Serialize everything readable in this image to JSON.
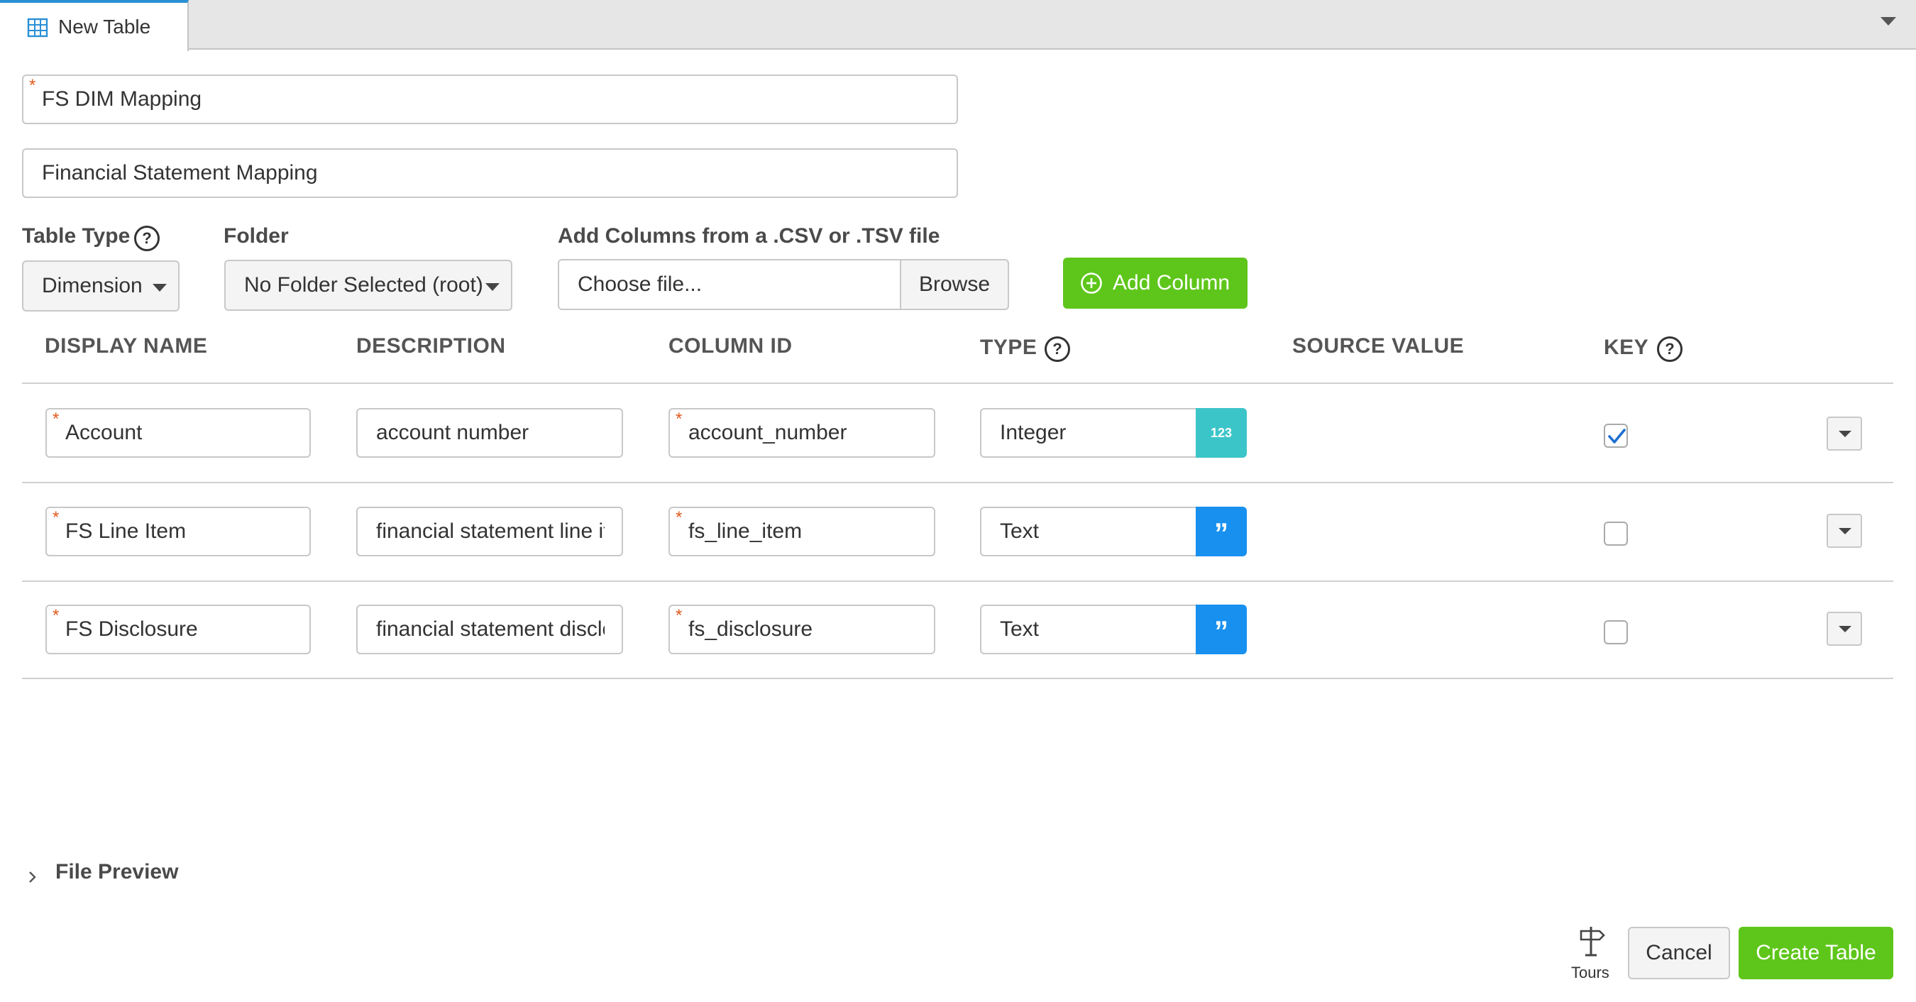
{
  "tab": {
    "label": "New Table",
    "icon": "table-grid-icon"
  },
  "form": {
    "name_value": "FS DIM Mapping",
    "description_value": "Financial Statement Mapping",
    "required_mark": "*"
  },
  "table_type": {
    "label": "Table Type",
    "help": "?",
    "value": "Dimension"
  },
  "folder": {
    "label": "Folder",
    "value": "No Folder Selected (root)"
  },
  "import": {
    "label": "Add Columns from a .CSV or .TSV file",
    "placeholder": "Choose file...",
    "browse_label": "Browse"
  },
  "add_column": {
    "label": "Add Column",
    "icon": "plus-circle-icon"
  },
  "columns_header": {
    "display_name": "DISPLAY NAME",
    "description": "DESCRIPTION",
    "column_id": "COLUMN ID",
    "type": "TYPE",
    "source_value": "SOURCE VALUE",
    "key": "KEY",
    "help": "?"
  },
  "rows": [
    {
      "display_name": "Account",
      "description": "account number",
      "column_id": "account_number",
      "type": "Integer",
      "type_badge": "123",
      "type_icon": "number-icon",
      "key": true
    },
    {
      "display_name": "FS Line Item",
      "description": "financial statement line item",
      "column_id": "fs_line_item",
      "type": "Text",
      "type_badge": "”",
      "type_icon": "quote-icon",
      "key": false
    },
    {
      "display_name": "FS Disclosure",
      "description": "financial statement disclosure",
      "column_id": "fs_disclosure",
      "type": "Text",
      "type_badge": "”",
      "type_icon": "quote-icon",
      "key": false
    }
  ],
  "file_preview": {
    "label": "File Preview",
    "icon": "chevron-right-icon"
  },
  "footer": {
    "tours_label": "Tours",
    "tours_icon": "signpost-icon",
    "cancel_label": "Cancel",
    "create_label": "Create Table"
  },
  "colors": {
    "accent_blue": "#2b8fd6",
    "green": "#5ec61a",
    "teal": "#3cc5c9",
    "text_badge_blue": "#1890f0",
    "required": "#e05a1e"
  }
}
